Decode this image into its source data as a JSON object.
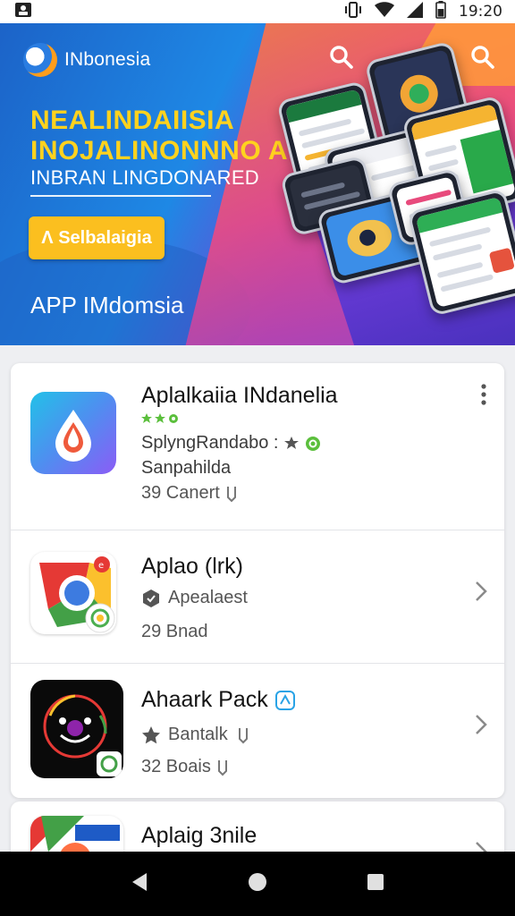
{
  "status_bar": {
    "time": "19:20"
  },
  "hero": {
    "brand": "INbonesia",
    "headline_line1": "NEALINDAIISIA",
    "headline_line2": "INOJALINONNNO A",
    "subheadline": "INBRAN LINGDONARED",
    "cta_label": "Ʌ Selbalaigia",
    "footer": "APP IMdomsia"
  },
  "apps": [
    {
      "title": "Aplalkaiia INdanelia",
      "line1": "SplyngRandabo :",
      "line2": "Sanpahilda",
      "line3": "39 Canert"
    },
    {
      "title": "Aplao (lrk)",
      "line1": "Apealaest",
      "line2": "29 Bnad"
    },
    {
      "title": "Ahaark Pack",
      "line1": "Bantalk",
      "line2": "32 Boais"
    },
    {
      "title": "Aplaig 3nile"
    }
  ],
  "colors": {
    "accent_yellow": "#ffd21e",
    "cta": "#fbbf1f",
    "hero_blue": "#1e88e5"
  }
}
